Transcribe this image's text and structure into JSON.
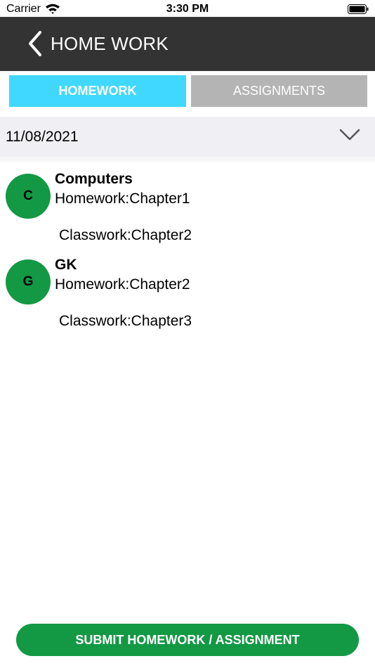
{
  "status_bar": {
    "carrier": "Carrier",
    "time": "3:30 PM"
  },
  "header": {
    "title": "HOME WORK"
  },
  "tabs": [
    {
      "label": "HOMEWORK",
      "active": true
    },
    {
      "label": "ASSIGNMENTS",
      "active": false
    }
  ],
  "date_selector": {
    "value": "11/08/2021"
  },
  "homework_list": [
    {
      "initial": "C",
      "subject": "Computers",
      "homework": "Homework:Chapter1",
      "classwork": "Classwork:Chapter2"
    },
    {
      "initial": "G",
      "subject": "GK",
      "homework": "Homework:Chapter2",
      "classwork": "Classwork:Chapter3"
    }
  ],
  "submit_button": {
    "label": "SUBMIT HOMEWORK / ASSIGNMENT"
  },
  "colors": {
    "header_bg": "#333333",
    "active_tab": "#41d8ff",
    "inactive_tab": "#b4b4b4",
    "accent_green": "#139844"
  }
}
